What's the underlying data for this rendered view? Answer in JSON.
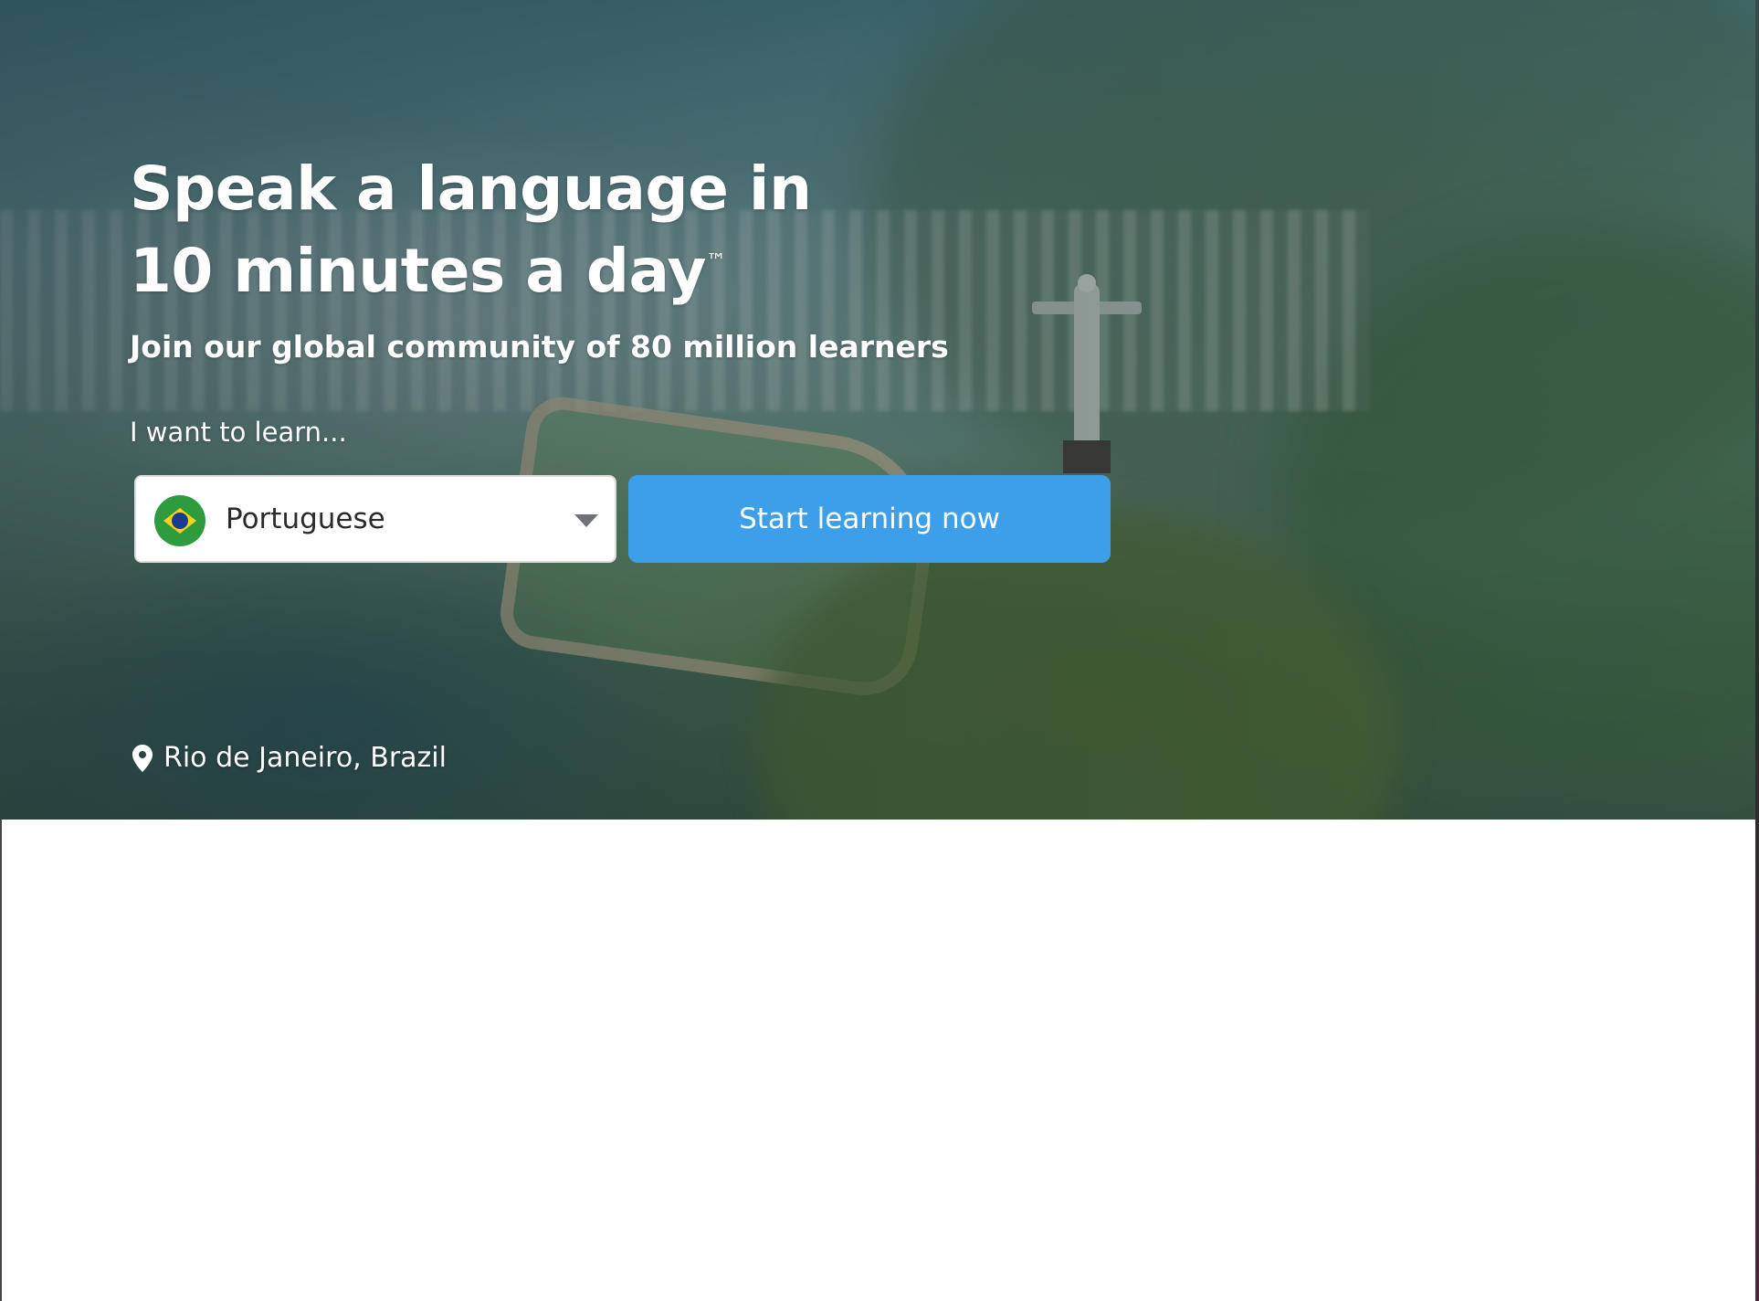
{
  "hero": {
    "headline_line1": "Speak a language in",
    "headline_line2": "10 minutes a day",
    "trademark": "™",
    "subheading": "Join our global community of 80 million learners",
    "learn_label": "I want to learn...",
    "location": "Rio de Janeiro, Brazil",
    "location_icon": "map-pin-icon"
  },
  "language_select": {
    "selected": "Portuguese",
    "flag_icon": "brazil-flag-icon",
    "dropdown_icon": "chevron-down-icon"
  },
  "cta": {
    "label": "Start learning now",
    "color": "#3d9ee9"
  }
}
